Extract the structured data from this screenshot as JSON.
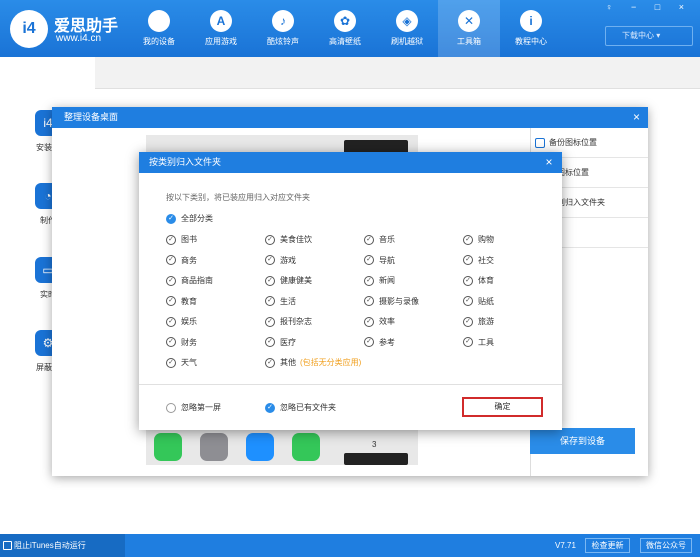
{
  "app": {
    "brand": "爱思助手",
    "url": "www.i4.cn",
    "logo_text": "i4"
  },
  "window_controls": "♀ − □ ×",
  "nav": [
    {
      "label": "我的设备",
      "icon": ""
    },
    {
      "label": "应用游戏",
      "icon": "A"
    },
    {
      "label": "酷炫铃声",
      "icon": "♪"
    },
    {
      "label": "高清壁纸",
      "icon": "✿"
    },
    {
      "label": "刷机越狱",
      "icon": "◈"
    },
    {
      "label": "工具箱",
      "icon": "✕"
    },
    {
      "label": "教程中心",
      "icon": "i"
    }
  ],
  "download_center": "下载中心 ▾",
  "side_tools": [
    "安装移",
    "制作",
    "实时",
    "屏蔽iO"
  ],
  "outer_dialog": {
    "title": "整理设备桌面",
    "close": "×",
    "right_items": [
      "备份图标位置",
      "恢复图标位置",
      "按类别归入文件夹",
      "按..."
    ],
    "right_items_visible": [
      "备份图标位置",
      "复图标位置",
      "类别归入文件夹",
      "行"
    ],
    "save_button": "保存到设备",
    "page_number": "3"
  },
  "inner_dialog": {
    "title": "按类别归入文件夹",
    "close": "×",
    "instruction": "按以下类别，将已装应用归入对应文件夹",
    "all_label": "全部分类",
    "categories": [
      "图书",
      "美食佳饮",
      "音乐",
      "购物",
      "商务",
      "游戏",
      "导航",
      "社交",
      "商品指南",
      "健康健美",
      "新闻",
      "体育",
      "教育",
      "生活",
      "摄影与录像",
      "贴纸",
      "娱乐",
      "报刊杂志",
      "效率",
      "旅游",
      "财务",
      "医疗",
      "参考",
      "工具",
      "天气",
      "其他"
    ],
    "other_note": "(包括无分类应用)",
    "skip_first_screen": "忽略第一屏",
    "skip_existing_folders": "忽略已有文件夹",
    "ok_button": "确定"
  },
  "status": {
    "block_itunes": "阻止iTunes自动运行",
    "version": "V7.71",
    "check_update": "检查更新",
    "wechat": "微信公众号"
  },
  "colors": {
    "primary": "#1f7ee0",
    "highlight_border": "#d12b2b",
    "note": "#f0a020"
  }
}
